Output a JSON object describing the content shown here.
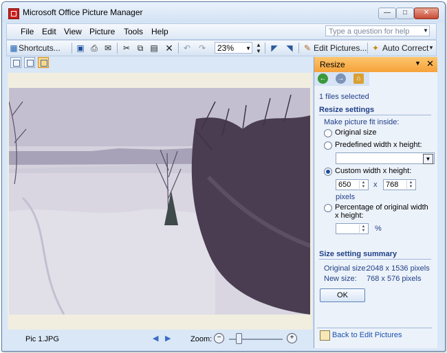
{
  "window": {
    "title": "Microsoft Office Picture Manager"
  },
  "menu": {
    "items": [
      "File",
      "Edit",
      "View",
      "Picture",
      "Tools",
      "Help"
    ],
    "help_placeholder": "Type a question for help"
  },
  "toolbar": {
    "shortcuts_label": "Shortcuts...",
    "zoom_value": "23%",
    "edit_pictures_label": "Edit Pictures...",
    "auto_correct_label": "Auto Correct"
  },
  "status": {
    "filename": "Pic 1.JPG",
    "zoom_label": "Zoom:",
    "zoom_slider_level": 0.15
  },
  "pane": {
    "title": "Resize",
    "files_selected": "1 files selected",
    "resize_settings_heading": "Resize settings",
    "fit_inside_label": "Make picture fit inside:",
    "options": [
      "Original size",
      "Predefined width x height:",
      "Custom width x height:",
      "Percentage of original width x height:"
    ],
    "selected_option": "Custom width x height:",
    "custom_width": "650",
    "custom_height": "768",
    "times_symbol": "x",
    "unit_label": "pixels",
    "percent_symbol": "%",
    "summary_heading": "Size setting summary",
    "original_size_label": "Original size:",
    "original_size_value": "2048 x 1536 pixels",
    "new_size_label": "New size:",
    "new_size_value": "768 x 576 pixels",
    "ok_label": "OK",
    "back_link": "Back to Edit Pictures"
  },
  "colors": {
    "accent_orange": "#f6a23a",
    "link_blue": "#1a4faa",
    "heading_blue": "#1f3f86"
  }
}
